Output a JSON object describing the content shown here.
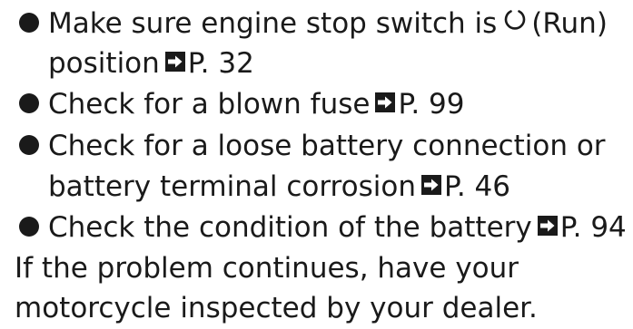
{
  "items": [
    {
      "line1_pre": "Make sure engine stop switch is",
      "line1_post": "(Run)",
      "line2_pre": "position",
      "ref": "P. 32"
    },
    {
      "text": "Check for a blown fuse",
      "ref": "P. 99"
    },
    {
      "line1": "Check for a loose battery connection or",
      "line2_pre": "battery terminal corrosion",
      "ref": "P. 46"
    },
    {
      "text": "Check the condition of the battery",
      "ref": "P. 94"
    }
  ],
  "footer": {
    "line1": "If the problem continues, have your",
    "line2": "motorcycle inspected by your dealer."
  },
  "icons": {
    "run_switch": "engine-stop-switch-run-icon",
    "page_reference": "page-reference-arrow-icon"
  }
}
